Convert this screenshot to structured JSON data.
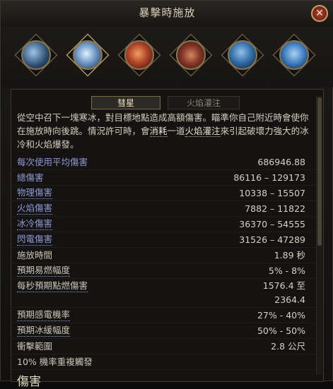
{
  "window": {
    "title": "暴擊時施放",
    "close_symbol": "✕"
  },
  "skill_icons": [
    {
      "name": "spirit-bird-icon",
      "color": "#4f7aa6"
    },
    {
      "name": "comet-icon",
      "color": "#9ab8d8"
    },
    {
      "name": "fire-orb-icon",
      "color": "#b0442a"
    },
    {
      "name": "fire-burst-icon",
      "color": "#8a3a2a"
    },
    {
      "name": "ice-orb-icon",
      "color": "#2e6aa3"
    },
    {
      "name": "ice-shard-icon",
      "color": "#3f7ec0"
    }
  ],
  "tabs": [
    {
      "label": "彗星",
      "active": true
    },
    {
      "label": "火焰灌注",
      "active": false
    }
  ],
  "description": {
    "part1": "從空中召下一塊寒冰，對目標地點造成高額傷害。瞄準你自己附近時會使你在施放時向後跳。情況許可時，會",
    "kw1": "消耗",
    "part2": "一道",
    "kw2": "火焰灌注",
    "part3": "來引起破壞力強大的冰冷和火焰爆發。"
  },
  "stats": [
    {
      "label": "每次使用平均傷害",
      "value": "686946.88",
      "color": "blue"
    },
    {
      "label": "總傷害",
      "value": "86116 – 129173",
      "color": "blue"
    },
    {
      "label": "物理傷害",
      "value": "10338 – 15507",
      "color": "blue",
      "underline": true
    },
    {
      "label": "火焰傷害",
      "value": "7882 – 11822",
      "color": "blue",
      "underline": true
    },
    {
      "label": "冰冷傷害",
      "value": "36370 – 54555",
      "color": "blue",
      "underline": true
    },
    {
      "label": "閃電傷害",
      "value": "31526 – 47289",
      "color": "blue",
      "underline": true
    },
    {
      "label": "施放時間",
      "value": "1.89 秒",
      "color": "plain"
    },
    {
      "label": "預期易燃幅度",
      "value": "5% - 8%",
      "color": "plain",
      "underline": true
    },
    {
      "label": "每秒預期點燃傷害",
      "value_line1": "1576.4 至",
      "value_line2": "2364.4",
      "color": "plain",
      "tall": true
    },
    {
      "label": "預期感電機率",
      "value": "27% - 40%",
      "color": "plain",
      "underline": true
    },
    {
      "label": "預期冰緩幅度",
      "value": "50% - 50%",
      "color": "plain",
      "underline": true
    },
    {
      "label": "衝擊範圍",
      "value": "2.8 公尺",
      "color": "plain"
    },
    {
      "label": "10% 機率重複觸發",
      "value": "",
      "color": "plain"
    }
  ],
  "section_heading": "傷害"
}
